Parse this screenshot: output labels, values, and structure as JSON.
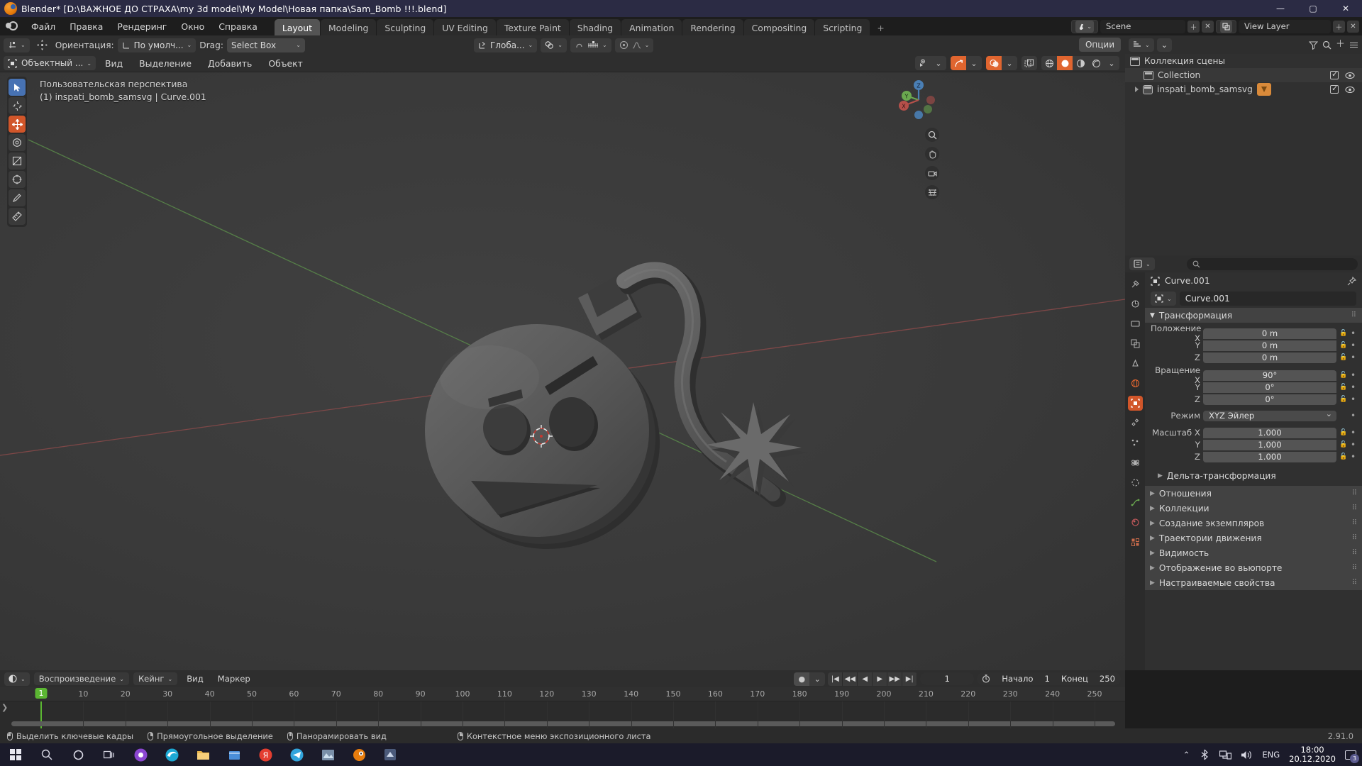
{
  "window": {
    "title": "Blender* [D:\\ВАЖНОЕ ДО СТРАХА\\my 3d model\\My Model\\Новая папка\\Sam_Bomb !!!.blend]",
    "minimize": "—",
    "maximize": "▢",
    "close": "✕"
  },
  "topbar": {
    "menus": [
      "Файл",
      "Правка",
      "Рендеринг",
      "Окно",
      "Справка"
    ],
    "tabs": [
      "Layout",
      "Modeling",
      "Sculpting",
      "UV Editing",
      "Texture Paint",
      "Shading",
      "Animation",
      "Rendering",
      "Compositing",
      "Scripting"
    ],
    "active_tab": "Layout",
    "add_tab": "+",
    "scene_name": "Scene",
    "view_layer_name": "View Layer"
  },
  "viewport_header": {
    "orientation_label": "Ориентация:",
    "orientation_value": "По умолч...",
    "drag_label": "Drag:",
    "drag_value": "Select Box",
    "transform_value": "Глоба...",
    "mode": "Объектный ...",
    "menus": [
      "Вид",
      "Выделение",
      "Добавить",
      "Объект"
    ],
    "options_label": "Опции"
  },
  "viewport": {
    "perspective_label": "Пользовательская перспектива",
    "object_label": "(1) inspati_bomb_samsvg | Curve.001",
    "gizmo_axes": [
      "Z",
      "Y",
      "X"
    ]
  },
  "outliner": {
    "root": "Коллекция сцены",
    "items": [
      {
        "name": "Collection",
        "indent": 1,
        "expandable": false,
        "badge": false
      },
      {
        "name": "inspati_bomb_samsvg",
        "indent": 1,
        "expandable": true,
        "badge": true
      }
    ]
  },
  "properties": {
    "breadcrumb": "Curve.001",
    "name_value": "Curve.001",
    "panel_transform": "Трансформация",
    "location": {
      "label": "Положение X",
      "x": "0 m",
      "y": "0 m",
      "z": "0 m"
    },
    "rotation": {
      "label": "Вращение X",
      "x": "90°",
      "y": "0°",
      "z": "0°"
    },
    "mode": {
      "label": "Режим",
      "value": "XYZ Эйлер"
    },
    "scale": {
      "label": "Масштаб X",
      "x": "1.000",
      "y": "1.000",
      "z": "1.000"
    },
    "axis_y": "Y",
    "axis_z": "Z",
    "subpanel_delta": "Дельта-трансформация",
    "panels": [
      "Отношения",
      "Коллекции",
      "Создание экземпляров",
      "Траектории движения",
      "Видимость",
      "Отображение во вьюпорте",
      "Настраиваемые свойства"
    ]
  },
  "timeline": {
    "playback": "Воспроизведение",
    "keying": "Кейнг",
    "view": "Вид",
    "marker": "Маркер",
    "current_frame": "1",
    "start_label": "Начало",
    "start_value": "1",
    "end_label": "Конец",
    "end_value": "250",
    "ticks": [
      "10",
      "20",
      "30",
      "40",
      "50",
      "60",
      "70",
      "80",
      "90",
      "100",
      "110",
      "120",
      "130",
      "140",
      "150",
      "160",
      "170",
      "180",
      "190",
      "200",
      "210",
      "220",
      "230",
      "240",
      "250"
    ],
    "playhead": "1"
  },
  "status": {
    "items": [
      {
        "mouse": "left",
        "text": "Выделить ключевые кадры"
      },
      {
        "mouse": "middle",
        "text": "Прямоугольное выделение"
      },
      {
        "mouse": "middle2",
        "text": "Панорамировать вид"
      },
      {
        "mouse": "right",
        "text": "Контекстное меню экспозиционного листа"
      }
    ],
    "version": "2.91.0"
  },
  "taskbar": {
    "language": "ENG",
    "time": "18:00",
    "date": "20.12.2020",
    "notification_count": "3"
  },
  "colors": {
    "accent_orange": "#d1562a",
    "select_blue": "#4772b3",
    "playhead_green": "#5bb632",
    "title_blue": "#2b2b44"
  }
}
